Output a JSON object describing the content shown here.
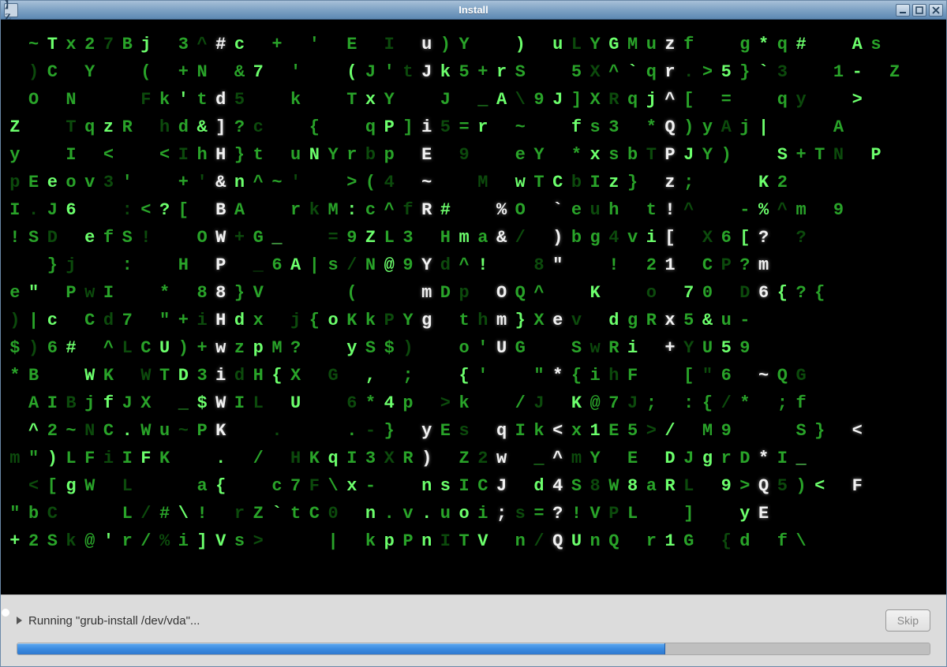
{
  "window": {
    "title": "Install",
    "controls": {
      "minimize": "minimize-icon",
      "maximize": "maximize-icon",
      "close": "close-icon"
    },
    "app_icon_glyph": "】Z"
  },
  "status": {
    "text": "Running \"grub-install /dev/vda\"...",
    "skip_label": "Skip",
    "progress_percent": 71
  },
  "colors": {
    "matrix_bg": "#000000",
    "matrix_dim": "#0c4a0c",
    "matrix_mid": "#29a329",
    "matrix_bright": "#6cff6c",
    "matrix_white": "#f2f2f2",
    "titlebar_grad_top": "#a8c0d8",
    "titlebar_grad_bot": "#5d88b3",
    "progress_fill": "#3b8be0",
    "panel_bg": "#dcdcdc"
  },
  "matrix": {
    "cols": 50,
    "white_columns": [
      11,
      22,
      26,
      29,
      35,
      40,
      45
    ],
    "rows": [
      " ~Tx27Bj 3^#c + ' E I u)Y  ) uLYGMuzf  g*q#  As  ",
      " )C Y  ( +N &7 '  (J'tJk5+rS  5X^`qr.>5}`3  1- Z",
      " O N   Fk'td5  k  TxY  J _A\\9J]XRqj^[ =  qy  >  ",
      "Z  TqzR hd&]?c  {  qP]i5=r ~  fs3 *Q)yAj|   A   ",
      "y  I <  <IhH}t uNYrbp E 9  eY *xsbTPJY)  S+TN P",
      "pEeov3'  +'&n^~'  >(4 ~  M wTCbIz} z;   K2     ",
      "I.J6  :<?[ BA  rkM:c^fR#  %O `euh t!^  -%^m 9 ",
      "!SD efS!  OW+G_  =9ZL3 Hma&/ )bg4vi[ X6[? ?   ",
      "  }j  :  H P _6A|s/N@9Yd^!  8\"  ! 21 CP?m      ",
      "e\" PwI  * 88}V    (   mDp OQ^  K  o 70 D6{?{  ",
      ")|c Cd7 \"+iHdx j{oKkPYg thm}Xev dgRx5&u-       ",
      "$)6# ^LCU)+wzpM?  yS$)  o'UG  SwRi +YU59       ",
      "*B  WK WTD3idH{X G , ;  {'  \"*{ihF  [\"6 ~QG    ",
      " AIBjfJX _$WIL U  6*4p >k  /J K@7J; :{/* ;f   ",
      " ^2~NC.Wu~PK  .   .-} yEs qIk<x1E5>/ M9   S} < ",
      "m\")LFiIFK  . / HKqI3XR) Z2w _^mY E DJgrD*I_    ",
      " <[gW L   a{  c7F\\x-  nsICJ d4S8W8aRL 9>Q5)< F",
      "\"bC   L/#\\! rZ`tC0 n.v.uoi;s=?!VPL  ]  yE      ",
      "+2Sk@'r/%i]Vs>   | kpPnITV n/QUnQ r1G {d f\\    "
    ]
  }
}
